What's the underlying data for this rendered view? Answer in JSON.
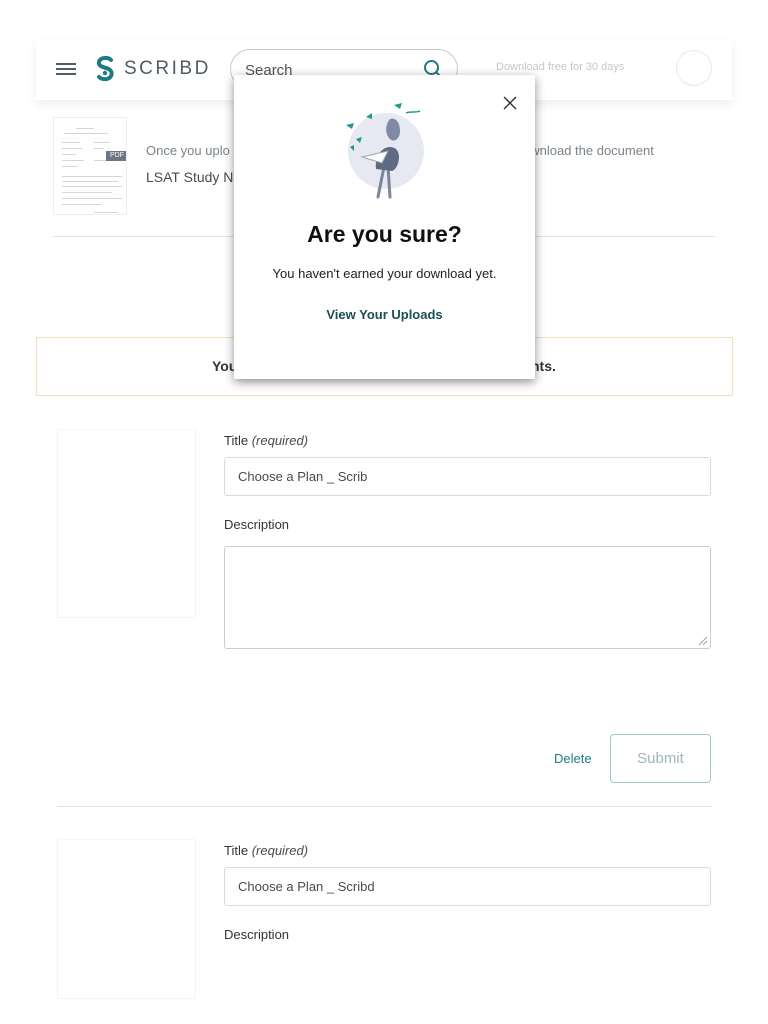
{
  "header": {
    "logo_text": "SCRIBD",
    "search_placeholder": "Search",
    "promo_text": "Download free for 30 days"
  },
  "document": {
    "note": "Once you uplo",
    "note_right": "ownload the document",
    "name": "LSAT Study N",
    "badge": "PDF"
  },
  "banner": {
    "text_left": "You",
    "text_right": "nts."
  },
  "uploads": [
    {
      "title_label": "Title ",
      "required_label": "(required)",
      "title_value": "Choose a Plan _ Scrib",
      "description_label": "Description",
      "description_value": "",
      "delete_label": "Delete",
      "submit_label": "Submit"
    },
    {
      "title_label": "Title ",
      "required_label": "(required)",
      "title_value": "Choose a Plan _ Scribd",
      "description_label": "Description"
    }
  ],
  "modal": {
    "title": "Are you sure?",
    "message": "You haven't earned your download yet.",
    "link_label": "View Your Uploads"
  },
  "colors": {
    "brand_teal": "#1e7b85",
    "link_dark_teal": "#1b4f56",
    "banner_border": "#f5dfc0"
  }
}
